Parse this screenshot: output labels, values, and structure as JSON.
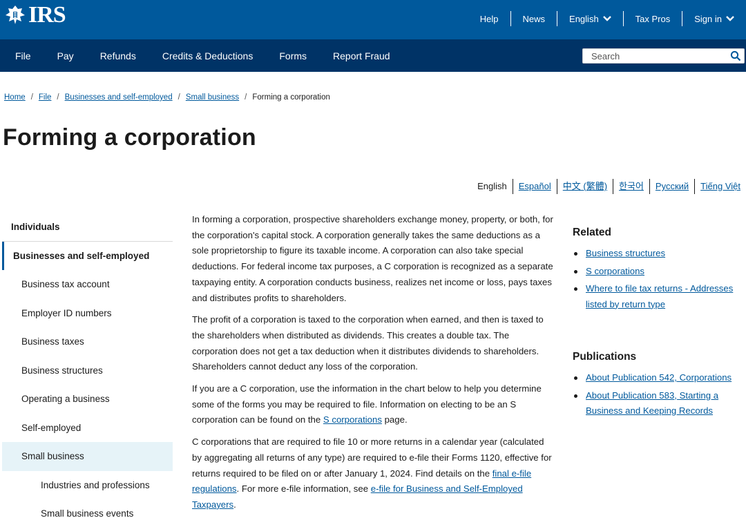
{
  "header": {
    "logo_text": "IRS",
    "utility_links": [
      "Help",
      "News",
      "English",
      "Tax Pros",
      "Sign in"
    ]
  },
  "nav": {
    "items": [
      "File",
      "Pay",
      "Refunds",
      "Credits & Deductions",
      "Forms",
      "Report Fraud"
    ],
    "search_placeholder": "Search"
  },
  "breadcrumb": {
    "items": [
      "Home",
      "File",
      "Businesses and self-employed",
      "Small business"
    ],
    "current": "Forming a corporation"
  },
  "page_title": "Forming a corporation",
  "languages": {
    "current": "English",
    "links": [
      "Español",
      "中文 (繁體)",
      "한국어",
      "Русский",
      "Tiếng Việt"
    ]
  },
  "sidebar": {
    "items": [
      "Individuals",
      "Businesses and self-employed",
      "Business tax account",
      "Employer ID numbers",
      "Business taxes",
      "Business structures",
      "Operating a business",
      "Self-employed",
      "Small business",
      "Industries and professions",
      "Small business events"
    ]
  },
  "main": {
    "p1": "In forming a corporation, prospective shareholders exchange money, property, or both, for the corporation's capital stock. A corporation generally takes the same deductions as a sole proprietorship to figure its taxable income. A corporation can also take special deductions. For federal income tax purposes, a C corporation is recognized as a separate taxpaying entity. A corporation conducts business, realizes net income or loss, pays taxes and distributes profits to shareholders.",
    "p2": "The profit of a corporation is taxed to the corporation when earned, and then is taxed to the shareholders when distributed as dividends. This creates a double tax. The corporation does not get a tax deduction when it distributes dividends to shareholders. Shareholders cannot deduct any loss of the corporation.",
    "p3_a": "If you are a C corporation, use the information in the chart below to help you determine some of the forms you may be required to file. Information on electing to be an S corporation can be found on the ",
    "p3_link": "S corporations",
    "p3_b": " page.",
    "p4_a": "C corporations that are required to file 10 or more returns in a calendar year (calculated by aggregating all returns of any type) are required to e-file their Forms 1120, effective for returns required to be filed on or after January 1, 2024. Find details on the ",
    "p4_link1": "final e-file regulations",
    "p4_b": ". For more e-file information, see ",
    "p4_link2": "e-file for Business and Self-Employed Taxpayers",
    "p4_c": "."
  },
  "related": {
    "heading": "Related",
    "links": [
      "Business structures",
      "S corporations",
      "Where to file tax returns - Addresses listed by return type"
    ]
  },
  "publications": {
    "heading": "Publications",
    "links": [
      "About Publication 542, Corporations",
      "About Publication 583, Starting a Business and Keeping Records"
    ]
  },
  "colors": {
    "header_blue": "#00599c",
    "nav_navy": "#003366",
    "link": "#00599c",
    "sidebar_active_bg": "#e6f3f8"
  }
}
